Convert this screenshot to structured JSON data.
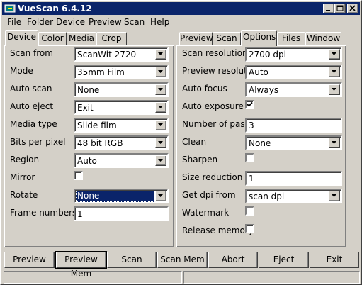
{
  "window": {
    "title": "VueScan 6.4.12",
    "buttons": [
      "minimize-icon",
      "maximize-icon",
      "close-icon"
    ]
  },
  "menu": [
    {
      "label": "File",
      "hotkey": "F"
    },
    {
      "label": "Folder",
      "hotkey": "o"
    },
    {
      "label": "Device",
      "hotkey": "D"
    },
    {
      "label": "Preview",
      "hotkey": "P"
    },
    {
      "label": "Scan",
      "hotkey": "S"
    },
    {
      "label": "Help",
      "hotkey": "H"
    }
  ],
  "left_tabs": [
    {
      "label": "Device",
      "active": true
    },
    {
      "label": "Color",
      "active": false
    },
    {
      "label": "Media",
      "active": false
    },
    {
      "label": "Crop",
      "active": false
    }
  ],
  "right_tabs": [
    {
      "label": "Preview",
      "active": false
    },
    {
      "label": "Scan",
      "active": false
    },
    {
      "label": "Options",
      "active": true
    },
    {
      "label": "Files",
      "active": false
    },
    {
      "label": "Window",
      "active": false
    }
  ],
  "device": {
    "scan_from": {
      "label": "Scan from",
      "value": "ScanWit 2720"
    },
    "mode": {
      "label": "Mode",
      "value": "35mm Film"
    },
    "auto_scan": {
      "label": "Auto scan",
      "value": "None"
    },
    "auto_eject": {
      "label": "Auto eject",
      "value": "Exit"
    },
    "media_type": {
      "label": "Media type",
      "value": "Slide film"
    },
    "bits_per_pixel": {
      "label": "Bits per pixel",
      "value": "48 bit RGB"
    },
    "region": {
      "label": "Region",
      "value": "Auto"
    },
    "mirror": {
      "label": "Mirror",
      "checked": false
    },
    "rotate": {
      "label": "Rotate",
      "value": "None"
    },
    "frame_numbers": {
      "label": "Frame numbers",
      "value": "1"
    }
  },
  "options": {
    "scan_resolution": {
      "label": "Scan resolution",
      "value": "2700 dpi"
    },
    "preview_resolution": {
      "label": "Preview resolution",
      "value": "Auto"
    },
    "auto_focus": {
      "label": "Auto focus",
      "value": "Always"
    },
    "auto_exposure": {
      "label": "Auto exposure",
      "checked": true
    },
    "number_of_passes": {
      "label": "Number of passes",
      "value": "3"
    },
    "clean": {
      "label": "Clean",
      "value": "None"
    },
    "sharpen": {
      "label": "Sharpen",
      "checked": false
    },
    "size_reduction": {
      "label": "Size reduction",
      "value": "1"
    },
    "get_dpi_from": {
      "label": "Get dpi from",
      "value": "scan dpi"
    },
    "watermark": {
      "label": "Watermark",
      "checked": false
    },
    "release_memory": {
      "label": "Release memory",
      "checked": false
    }
  },
  "buttons": {
    "preview": "Preview",
    "preview_mem": "Preview Mem",
    "scan": "Scan",
    "scan_mem": "Scan Mem",
    "abort": "Abort",
    "eject": "Eject",
    "exit": "Exit"
  },
  "status": {
    "left": "",
    "right": ""
  },
  "colors": {
    "titlebar": "#0a246a",
    "face": "#d4d0c8",
    "selection": "#0a246a"
  }
}
